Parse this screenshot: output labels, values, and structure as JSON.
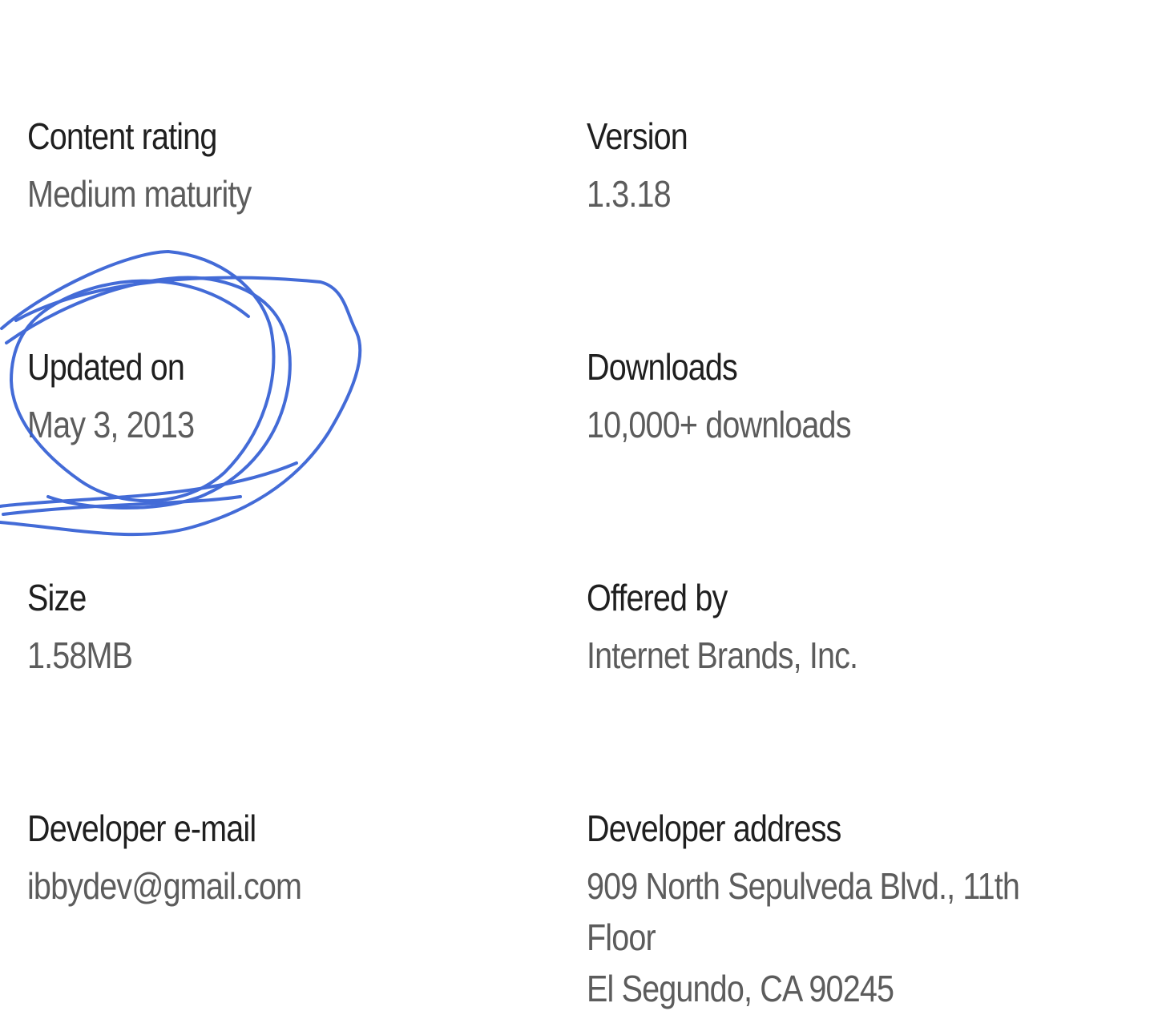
{
  "details": [
    {
      "label": "Content rating",
      "value": "Medium maturity"
    },
    {
      "label": "Version",
      "value": "1.3.18"
    },
    {
      "label": "Updated on",
      "value": "May 3, 2013"
    },
    {
      "label": "Downloads",
      "value": "10,000+ downloads"
    },
    {
      "label": "Size",
      "value": "1.58MB"
    },
    {
      "label": "Offered by",
      "value": "Internet Brands, Inc."
    },
    {
      "label": "Developer e-mail",
      "value": "ibbydev@gmail.com"
    },
    {
      "label": "Developer address",
      "value_lines": [
        "909 North Sepulveda Blvd., 11th",
        "Floor",
        "El Segundo, CA 90245"
      ]
    }
  ],
  "colors": {
    "label": "#1f1f1f",
    "value": "#5c5c5c",
    "annotation_ink": "#2f5bd3"
  }
}
